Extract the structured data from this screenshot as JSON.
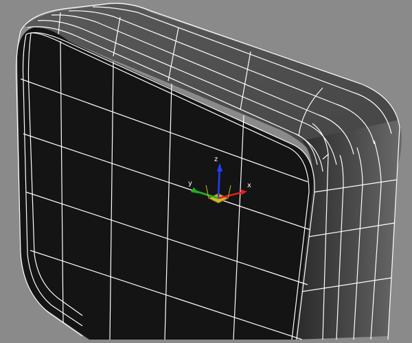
{
  "viewport": {
    "background": "#8a8a8a",
    "object": {
      "name": "rounded-box-mesh",
      "front_face_color": "#151515",
      "top_face_color": "#4a4a4a",
      "side_face_color": "#3a3a3a",
      "wireframe_color": "#ffffff"
    },
    "gizmo": {
      "x_label": "x",
      "y_label": "y",
      "z_label": "z",
      "x_color": "#e02020",
      "y_color": "#20b020",
      "z_color": "#2040ff",
      "plane_color": "#d4b430"
    }
  }
}
